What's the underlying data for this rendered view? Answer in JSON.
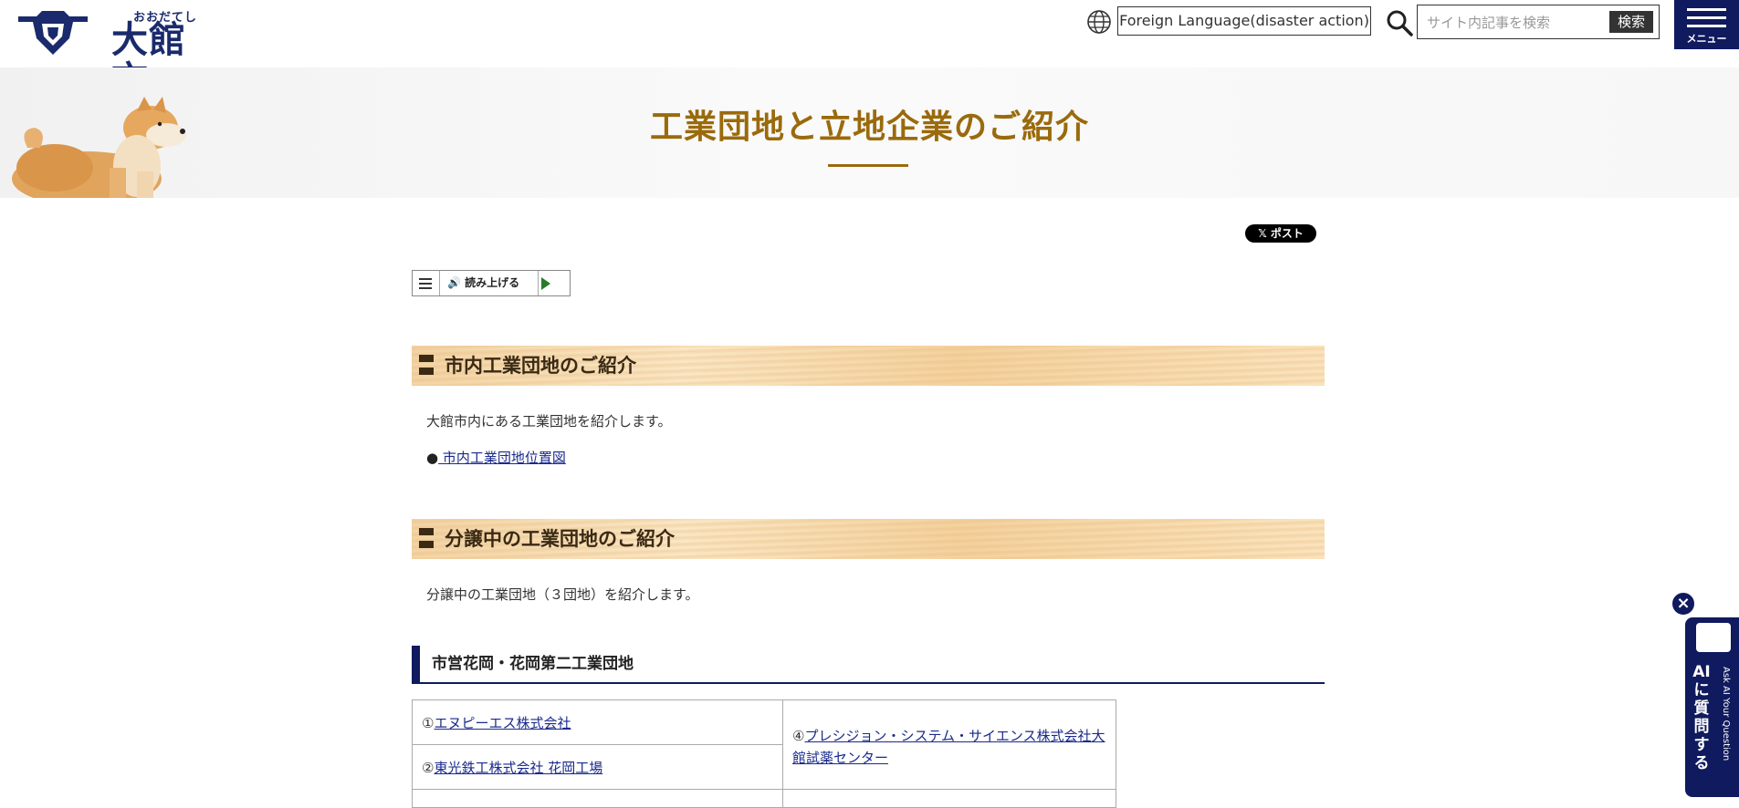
{
  "header": {
    "logo_kana": "おおだてし",
    "logo_kanji": "大館市",
    "lang_button": "Foreign Language(disaster action)",
    "search_placeholder": "サイト内記事を検索",
    "search_button": "検索",
    "menu_label": "メニュー"
  },
  "hero": {
    "title": "工業団地と立地企業のご紹介"
  },
  "share": {
    "x_post": "𝕏 ポスト"
  },
  "reader": {
    "label": "🔊 読み上げる"
  },
  "sections": [
    {
      "heading": "市内工業団地のご紹介",
      "text": "大館市内にある工業団地を紹介します。",
      "bullet": "●",
      "link": " 市内工業団地位置図"
    },
    {
      "heading": "分譲中の工業団地のご紹介",
      "text": "分譲中の工業団地（３団地）を紹介します。"
    }
  ],
  "subsection": {
    "heading": "市営花岡・花岡第二工業団地"
  },
  "companies": {
    "c1_num": "①",
    "c1_name": "エヌピーエス株式会社",
    "c2_num": "②",
    "c2_name": "東光鉄工株式会社 花岡工場",
    "c4_num": "④",
    "c4_name": "プレシジョン・システム・サイエンス株式会社大館試薬センター"
  },
  "ai_widget": {
    "close": "×",
    "main": "AIに質問する",
    "sub": "Ask AI Your Question"
  }
}
